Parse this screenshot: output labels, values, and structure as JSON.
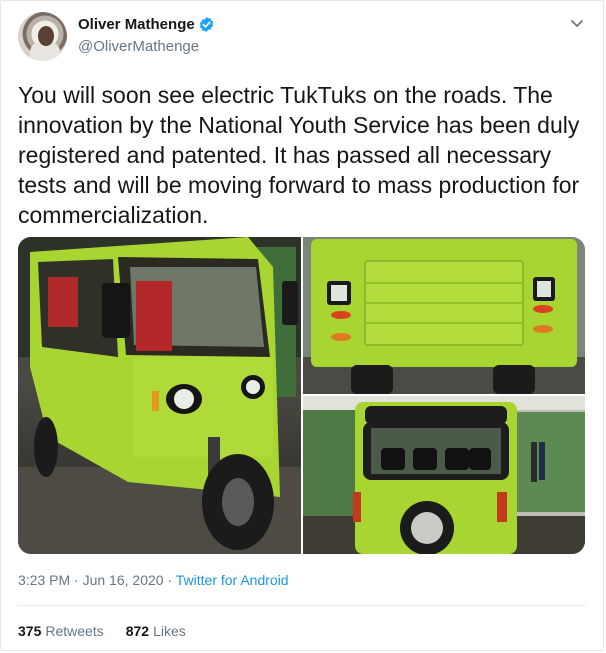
{
  "author": {
    "name": "Oliver Mathenge",
    "handle": "@OliverMathenge",
    "verified": true
  },
  "tweet": {
    "text": "You will soon see electric TukTuks on the roads. The innovation by the National Youth Service has been duly registered and patented. It has passed all necessary tests and will be moving forward to mass production for commercialization.",
    "time": "3:23 PM",
    "date": "Jun 16, 2020",
    "separator": "·",
    "source": "Twitter for Android"
  },
  "stats": {
    "retweets_count": "375",
    "retweets_label": "Retweets",
    "likes_count": "872",
    "likes_label": "Likes"
  },
  "icons": {
    "verified": "verified-badge-icon",
    "menu": "chevron-down-icon"
  },
  "colors": {
    "accent": "#1da1f2",
    "link": "#1b95e0",
    "tuktuk_green": "#a8d531"
  }
}
